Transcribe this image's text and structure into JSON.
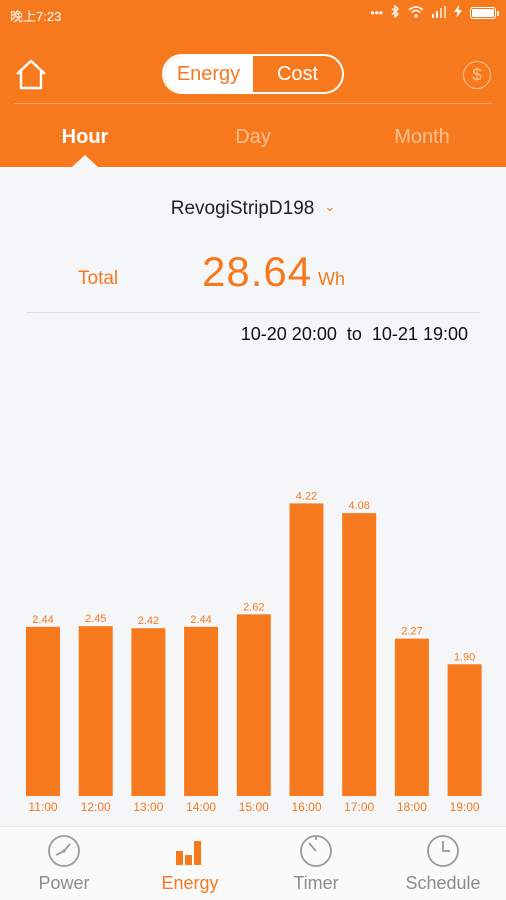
{
  "status_bar": {
    "time": "晚上7:23"
  },
  "header": {
    "toggle": {
      "energy_label": "Energy",
      "cost_label": "Cost",
      "selected": "Energy"
    },
    "dollar_symbol": "$"
  },
  "tabs": [
    {
      "label": "Hour",
      "active": true
    },
    {
      "label": "Day",
      "active": false
    },
    {
      "label": "Month",
      "active": false
    }
  ],
  "device": {
    "name": "RevogiStripD198"
  },
  "summary": {
    "total_label": "Total",
    "total_value": "28.64",
    "unit": "Wh",
    "range_from": "10-20 20:00",
    "range_to_word": "to",
    "range_to": "10-21 19:00"
  },
  "chart_data": {
    "type": "bar",
    "categories": [
      "11:00",
      "12:00",
      "13:00",
      "14:00",
      "15:00",
      "16:00",
      "17:00",
      "18:00",
      "19:00"
    ],
    "values": [
      2.44,
      2.45,
      2.42,
      2.44,
      2.62,
      4.22,
      4.08,
      2.27,
      1.9
    ],
    "labels": [
      "2.44",
      "2.45",
      "2.42",
      "2.44",
      "2.62",
      "4.22",
      "4.08",
      "2.27",
      "1.90"
    ],
    "ylim": [
      0,
      6.0
    ],
    "color": "#f6791e",
    "title": "",
    "xlabel": "",
    "ylabel": ""
  },
  "nav": [
    {
      "label": "Power",
      "icon": "gauge-icon",
      "active": false
    },
    {
      "label": "Energy",
      "icon": "bar-chart-icon",
      "active": true
    },
    {
      "label": "Timer",
      "icon": "timer-icon",
      "active": false
    },
    {
      "label": "Schedule",
      "icon": "clock-icon",
      "active": false
    }
  ],
  "colors": {
    "accent": "#f6791e",
    "inactive": "#8c8c8c"
  }
}
